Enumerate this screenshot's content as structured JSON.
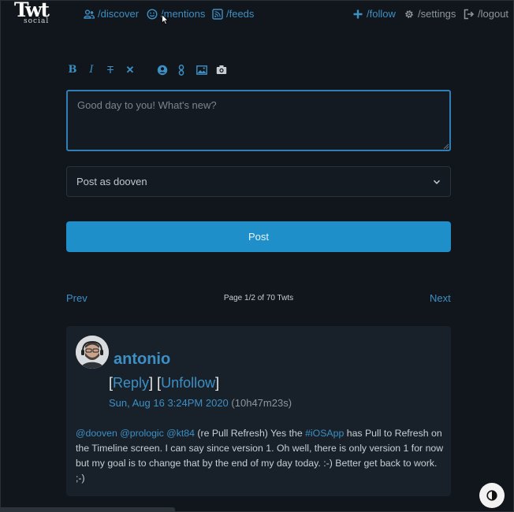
{
  "app": {
    "logo_text": "Twt",
    "logo_subtext": "social"
  },
  "nav": {
    "discover": "/discover",
    "mentions": "/mentions",
    "feeds": "/feeds",
    "follow": "/follow",
    "settings": "/settings",
    "logout": "/logout"
  },
  "toolbar": {
    "bold": "B",
    "italic": "I",
    "strike": "T",
    "clear": "✕"
  },
  "composer": {
    "placeholder": "Good day to you! What's new?"
  },
  "post_as": {
    "selected": "Post as dooven"
  },
  "post_button": {
    "label": "Post"
  },
  "pagination": {
    "prev": "Prev",
    "next": "Next",
    "info": "Page 1/2 of 70 Twts"
  },
  "twt": {
    "author": "antonio",
    "bracket_open": "[",
    "bracket_close": "]",
    "reply": "Reply",
    "unfollow": "Unfollow",
    "timestamp": "Sun, Aug 16 3:24PM 2020",
    "relative": "(10h47m23s)",
    "mentions": [
      "@dooven",
      "@prologic",
      "@kt84"
    ],
    "text_1": "(re Pull Refresh) Yes the",
    "hashtag": "#iOSApp",
    "text_2": "has Pull to Refresh on the Timeline screen. I can say since version 1. Oh well, there is only version 1 for now but my goal is to change that by the end of my day today. :-) Better get back to work. ;-)"
  },
  "colors": {
    "accent": "#3d8fc4",
    "button": "#1e8fc8",
    "background": "#11161c",
    "card": "#18212a"
  }
}
